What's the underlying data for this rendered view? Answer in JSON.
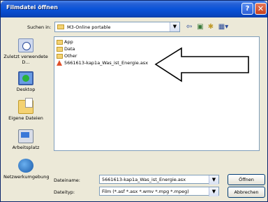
{
  "window": {
    "title": "Filmdatei öffnen"
  },
  "titlebar": {
    "help_glyph": "?",
    "close_glyph": "✕"
  },
  "lookin": {
    "label": "Suchen in:",
    "value": "M3-Online portable"
  },
  "toolbar": {
    "back_glyph": "⇦",
    "up_glyph": "▣",
    "newfolder_glyph": "✱",
    "views_glyph": "▦▾"
  },
  "places": [
    {
      "label": "Zuletzt verwendete D...",
      "icon": "recent-documents-icon"
    },
    {
      "label": "Desktop",
      "icon": "desktop-icon"
    },
    {
      "label": "Eigene Dateien",
      "icon": "my-documents-icon"
    },
    {
      "label": "Arbeitsplatz",
      "icon": "my-computer-icon"
    },
    {
      "label": "Netzwerkumgebung",
      "icon": "network-places-icon"
    }
  ],
  "files": [
    {
      "name": "App",
      "type": "folder"
    },
    {
      "name": "Data",
      "type": "folder"
    },
    {
      "name": "Other",
      "type": "folder"
    },
    {
      "name": "5661613-kap1a_Was_ist_Energie.asx",
      "type": "asx"
    }
  ],
  "filename": {
    "label": "Dateiname:",
    "value": "5661613-kap1a_Was_ist_Energie.asx"
  },
  "filetype": {
    "label": "Dateityp:",
    "value": "Film (*.asf *.asx *.wmv *.mpg *.mpeg)"
  },
  "buttons": {
    "open": "Öffnen",
    "cancel": "Abbrechen"
  },
  "colors": {
    "titlebar": "#0a53d8",
    "dialog_bg": "#ece9d8",
    "border": "#7f9db9"
  }
}
